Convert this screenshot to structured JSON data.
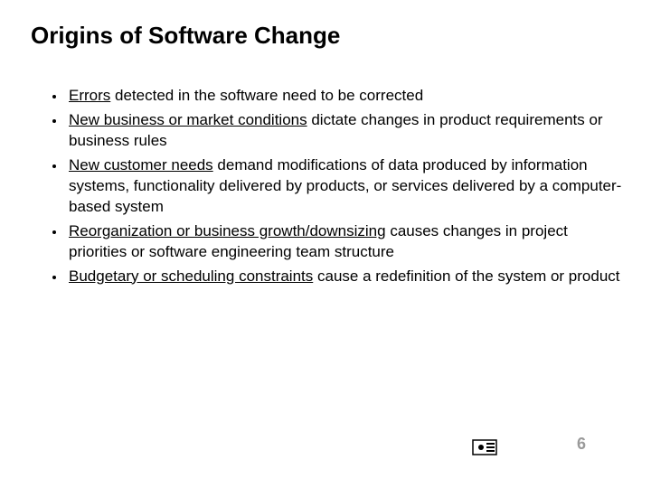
{
  "title": "Origins of Software Change",
  "bullets": [
    {
      "underline": "Errors",
      "rest": " detected in the software need to be corrected"
    },
    {
      "underline": "New business or market conditions",
      "rest": " dictate changes in product requirements or business rules"
    },
    {
      "underline": "New customer needs",
      "rest": " demand modifications of data produced by information systems, functionality delivered by products, or services delivered by a computer-based system"
    },
    {
      "underline": "Reorganization or business growth/downsizing",
      "rest": " causes changes in project priorities or software engineering team structure"
    },
    {
      "underline": "Budgetary or scheduling constraints",
      "rest": " cause a redefinition of the system or product"
    }
  ],
  "page_number": "6"
}
